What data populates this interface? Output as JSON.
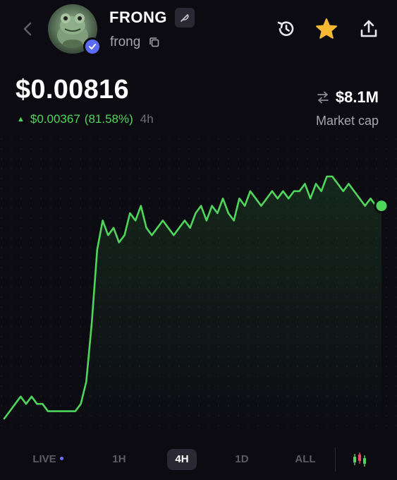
{
  "header": {
    "token_name": "FRONG",
    "token_symbol": "frong",
    "icons": {
      "back": "chevron-left-icon",
      "history": "history-icon",
      "favorite": "star-icon",
      "share": "share-icon",
      "edit": "feather-icon",
      "copy": "copy-icon",
      "verified": "verified-check-icon"
    },
    "colors": {
      "favorite_star": "#f5b932",
      "verified": "#5b6cf4"
    }
  },
  "price": {
    "value": "$0.00816",
    "change_amount": "$0.00367",
    "change_percent": "(81.58%)",
    "timeframe": "4h",
    "direction": "up"
  },
  "market_cap": {
    "value": "$8.1M",
    "label": "Market cap",
    "icon": "swap-arrows-icon"
  },
  "chart_data": {
    "type": "line",
    "series": [
      {
        "color": "#4fd65a",
        "values": [
          0.0045,
          0.0046,
          0.0047,
          0.0048,
          0.0047,
          0.0048,
          0.0047,
          0.0047,
          0.0046,
          0.0046,
          0.0046,
          0.0046,
          0.0046,
          0.0046,
          0.0047,
          0.005,
          0.0058,
          0.0068,
          0.0072,
          0.007,
          0.0071,
          0.0069,
          0.007,
          0.0073,
          0.0072,
          0.0074,
          0.0071,
          0.007,
          0.0071,
          0.0072,
          0.0071,
          0.007,
          0.0071,
          0.0072,
          0.0071,
          0.0073,
          0.0074,
          0.0072,
          0.0074,
          0.0073,
          0.0075,
          0.0073,
          0.0072,
          0.0075,
          0.0074,
          0.0076,
          0.0075,
          0.0074,
          0.0075,
          0.0076,
          0.0075,
          0.0076,
          0.0075,
          0.0076,
          0.0076,
          0.0077,
          0.0075,
          0.0077,
          0.0076,
          0.0078,
          0.0078,
          0.0077,
          0.0076,
          0.0077,
          0.0076,
          0.0075,
          0.0074,
          0.0075,
          0.0074,
          0.0074
        ]
      }
    ],
    "last_point_marker": true
  },
  "timeframes": {
    "items": [
      {
        "label": "LIVE",
        "live": true
      },
      {
        "label": "1H"
      },
      {
        "label": "4H",
        "active": true
      },
      {
        "label": "1D"
      },
      {
        "label": "ALL"
      }
    ],
    "candles_icon": "candlestick-chart-icon"
  }
}
